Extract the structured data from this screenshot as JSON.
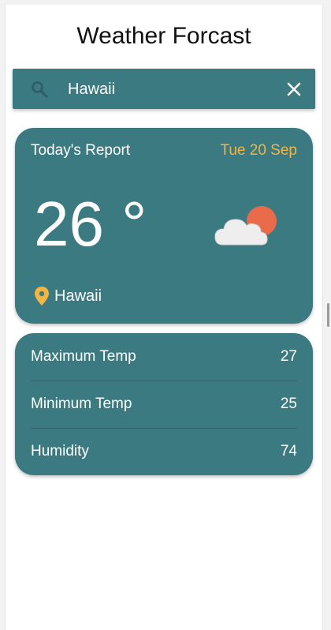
{
  "app": {
    "title": "Weather Forcast"
  },
  "search": {
    "value": "Hawaii",
    "icon": "search-icon",
    "clear_icon": "close-icon"
  },
  "report": {
    "label": "Today's Report",
    "date": "Tue 20 Sep",
    "temperature": "26 °",
    "weather_icon": "partly-cloudy-icon",
    "location": "Hawaii",
    "location_icon": "location-pin-icon"
  },
  "stats": {
    "rows": [
      {
        "label": "Maximum Temp",
        "value": "27"
      },
      {
        "label": "Minimum Temp",
        "value": "25"
      },
      {
        "label": "Humidity",
        "value": "74"
      }
    ]
  },
  "colors": {
    "card": "#3c7a82",
    "accent": "#f3b542",
    "sun": "#ea6b4b",
    "cloud": "#eeeeee"
  }
}
